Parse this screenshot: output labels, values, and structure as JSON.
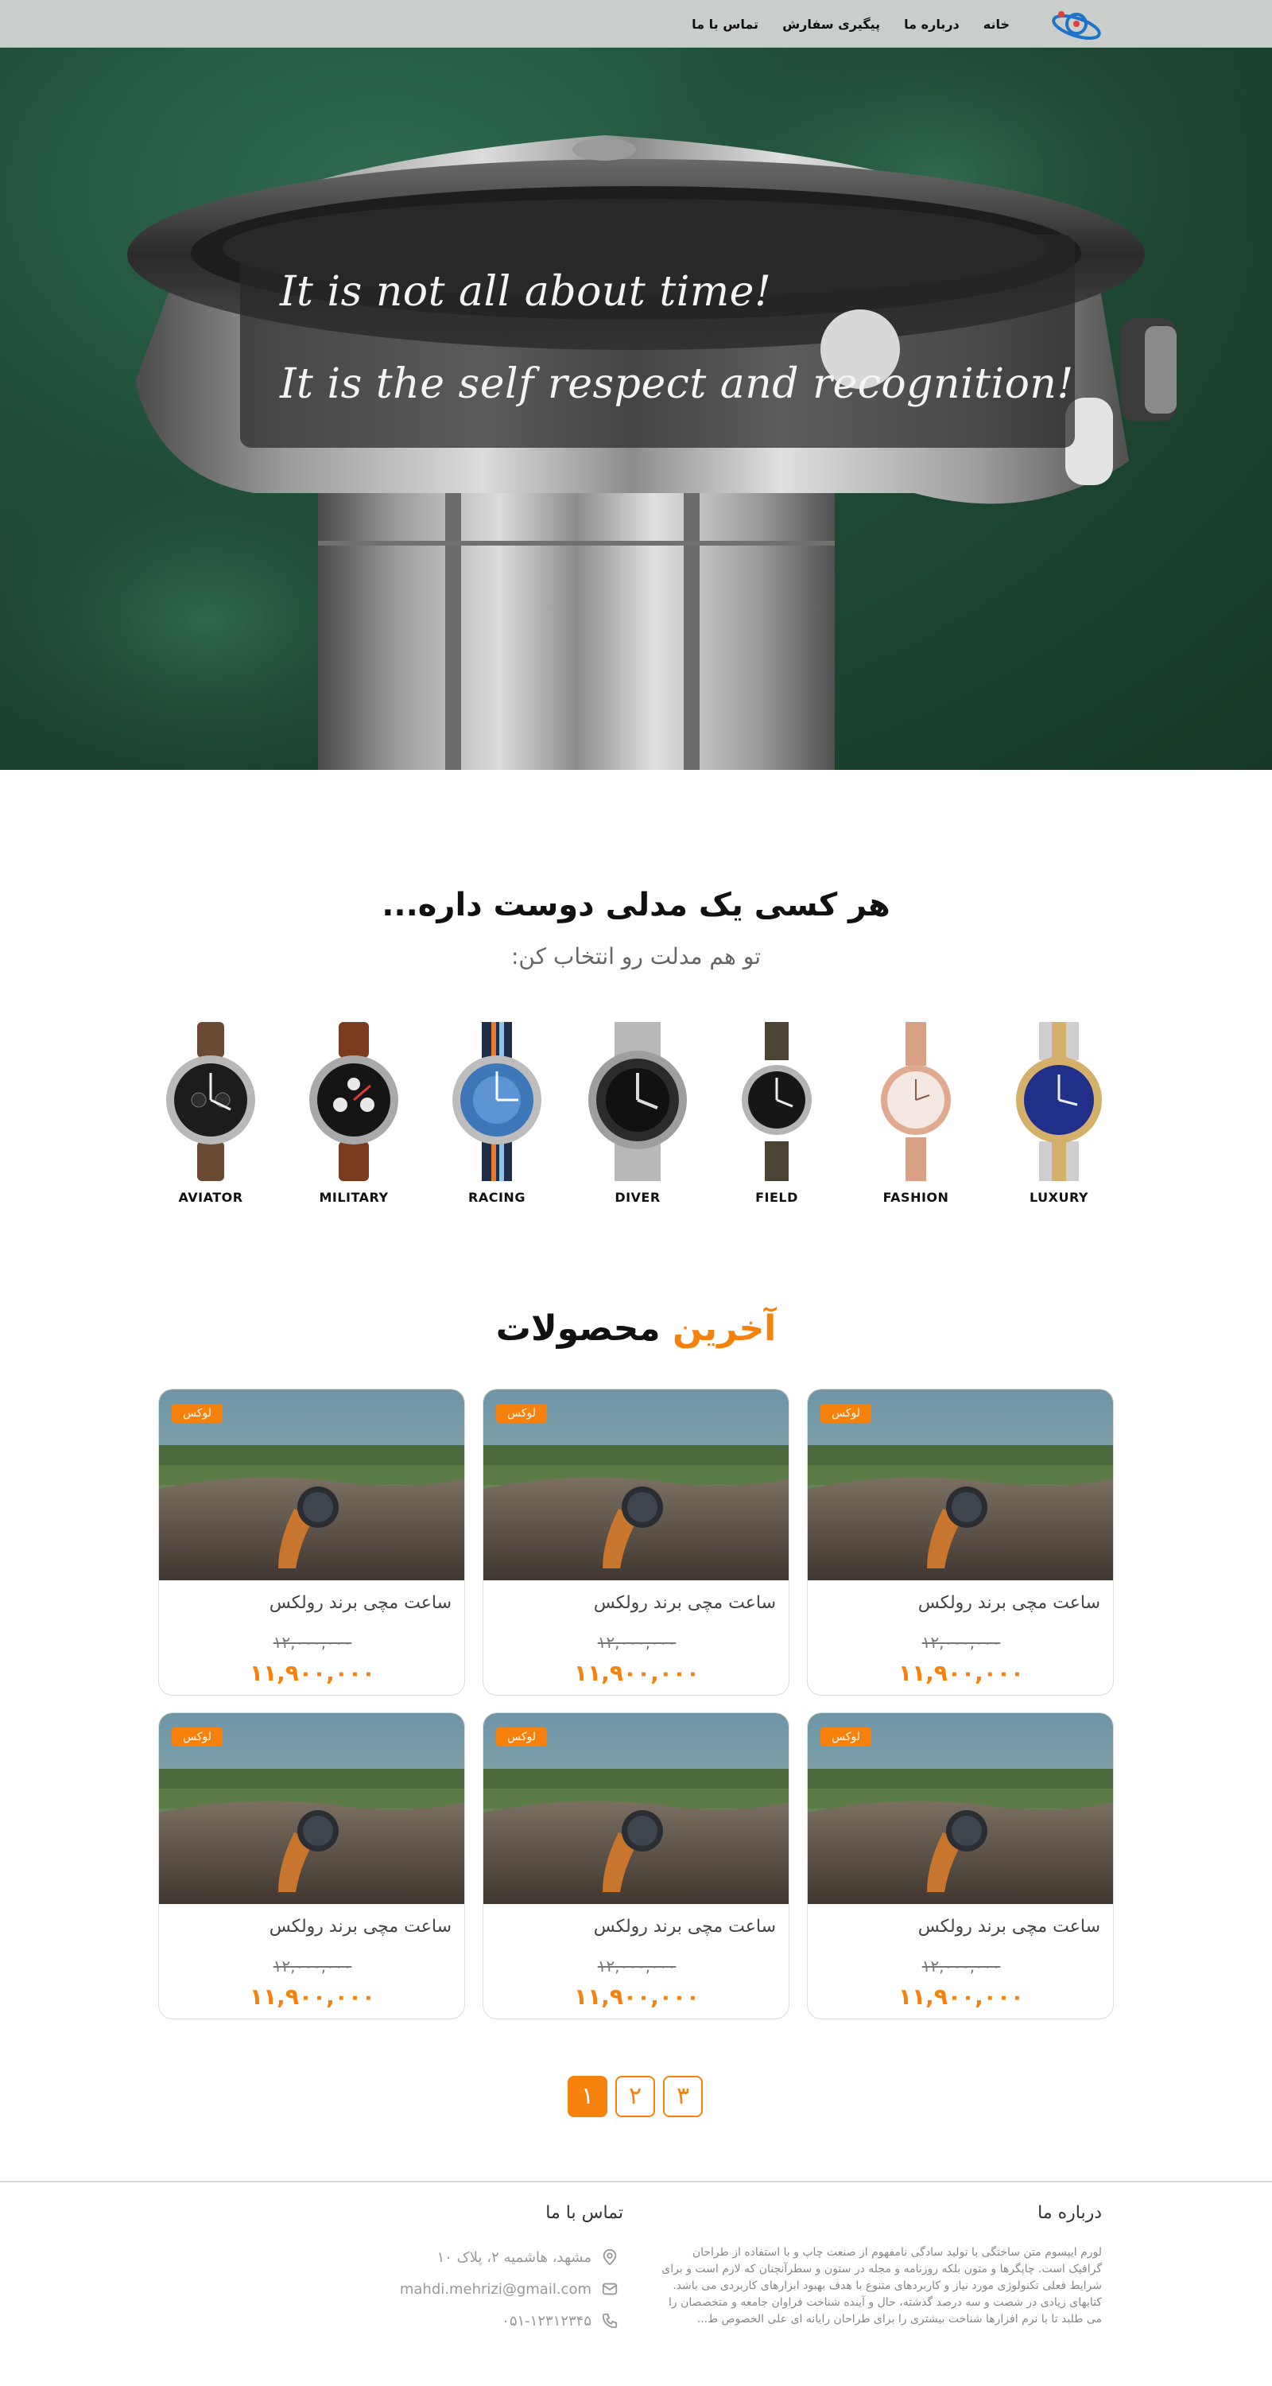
{
  "nav": {
    "items": [
      "خانه",
      "درباره ما",
      "پیگیری سفارش",
      "تماس با ما"
    ]
  },
  "hero": {
    "line1": "It is not all about time!",
    "line2": "It is the self respect and recognition!"
  },
  "categories_section": {
    "title": "هر کسی یک مدلی دوست داره...",
    "subtitle": "تو هم مدلت رو انتخاب کن:",
    "items": [
      "AVIATOR",
      "MILITARY",
      "RACING",
      "DIVER",
      "FIELD",
      "FASHION",
      "LUXURY"
    ]
  },
  "latest": {
    "title_accent": "آخرین",
    "title_rest": "محصولات",
    "products": [
      {
        "badge": "لوکس",
        "title": "ساعت مچی برند رولکس",
        "old_price": "۱۲,۰۰۰,۰۰۰",
        "price": "۱۱,۹۰۰,۰۰۰"
      },
      {
        "badge": "لوکس",
        "title": "ساعت مچی برند رولکس",
        "old_price": "۱۲,۰۰۰,۰۰۰",
        "price": "۱۱,۹۰۰,۰۰۰"
      },
      {
        "badge": "لوکس",
        "title": "ساعت مچی برند رولکس",
        "old_price": "۱۲,۰۰۰,۰۰۰",
        "price": "۱۱,۹۰۰,۰۰۰"
      },
      {
        "badge": "لوکس",
        "title": "ساعت مچی برند رولکس",
        "old_price": "۱۲,۰۰۰,۰۰۰",
        "price": "۱۱,۹۰۰,۰۰۰"
      },
      {
        "badge": "لوکس",
        "title": "ساعت مچی برند رولکس",
        "old_price": "۱۲,۰۰۰,۰۰۰",
        "price": "۱۱,۹۰۰,۰۰۰"
      },
      {
        "badge": "لوکس",
        "title": "ساعت مچی برند رولکس",
        "old_price": "۱۲,۰۰۰,۰۰۰",
        "price": "۱۱,۹۰۰,۰۰۰"
      }
    ]
  },
  "pagination": {
    "pages": [
      "۱",
      "۲",
      "۳"
    ],
    "active": 0
  },
  "footer": {
    "about_title": "درباره ما",
    "about_text": "لورم ایپسوم متن ساختگی با تولید سادگی نامفهوم از صنعت چاپ و با استفاده از طراحان گرافیک است. چاپگرها و متون بلکه روزنامه و مجله در ستون و سطرآنچنان که لازم است و برای شرایط فعلی تکنولوژی مورد نیاز و کاربردهای متنوع با هدف بهبود ابزارهای کاربردی می باشد. کتابهای زیادی در شصت و سه درصد گذشته، حال و آینده شناخت فراوان جامعه و متخصصان را می طلبد تا با نرم افزارها شناخت بیشتری را برای طراحان رایانه ای علی الخصوص ط...",
    "contact_title": "تماس با ما",
    "address": "مشهد، هاشمیه ۲، پلاک ۱۰",
    "email": "mahdi.mehrizi@gmail.com",
    "phone": "۰۵۱-۱۲۳۱۲۳۴۵"
  },
  "colors": {
    "accent": "#f7810d",
    "navbar": "#c9ceca",
    "hero_green": "#1f4d39"
  },
  "icons": [
    "logo-icon",
    "location-icon",
    "mail-icon",
    "phone-icon"
  ]
}
